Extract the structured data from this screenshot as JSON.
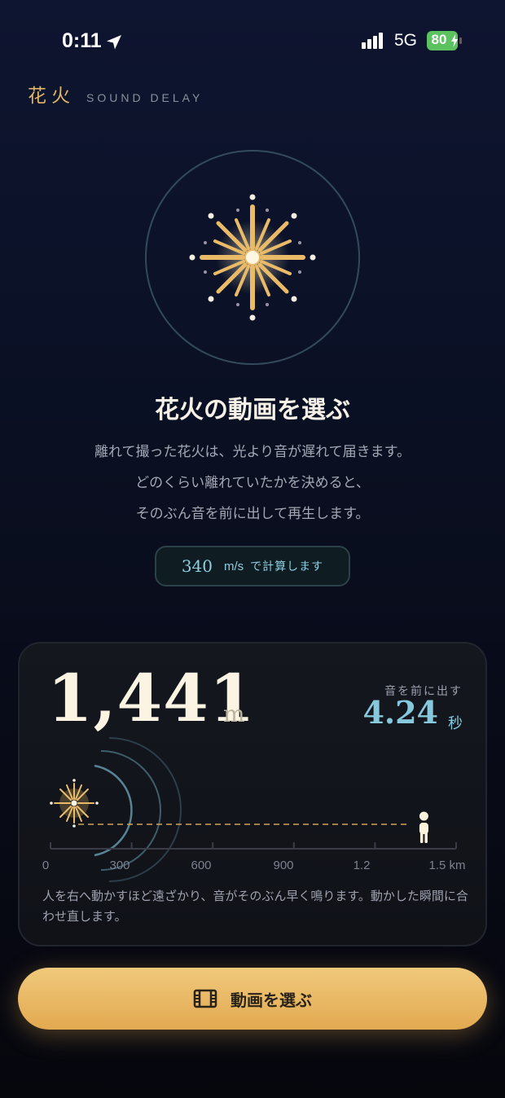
{
  "status_bar": {
    "time": "0:11",
    "network": "5G",
    "battery": "80"
  },
  "brand": {
    "kanji": "花火",
    "subtitle": "SOUND DELAY"
  },
  "hero": {
    "title": "花火の動画を選ぶ",
    "description": [
      "離れて撮った花火は、光より音が遅れて届きます。",
      "どのくらい離れていたかを決めると、",
      "そのぶん音を前に出して再生します。"
    ]
  },
  "speed": {
    "value": "340",
    "unit": "m/s",
    "suffix": "で計算します"
  },
  "distance_card": {
    "distance_value": "1,441",
    "distance_unit": "m",
    "delay_label": "音を前に出す",
    "delay_value": "4.24",
    "delay_unit": "秒",
    "scale_ticks": [
      "0",
      "300",
      "600",
      "900",
      "1.2",
      "1.5 km"
    ],
    "slider_fraction": 0.9607,
    "note": "人を右へ動かすほど遠ざかり、音がそのぶん早く鳴ります。動かした瞬間に合わせ直します。"
  },
  "cta": {
    "label": "動画を選ぶ",
    "icon": "film-icon"
  },
  "colors": {
    "accent_gold": "#e0b464",
    "accent_blue": "#86c8dc",
    "battery_green": "#5cc25f"
  }
}
